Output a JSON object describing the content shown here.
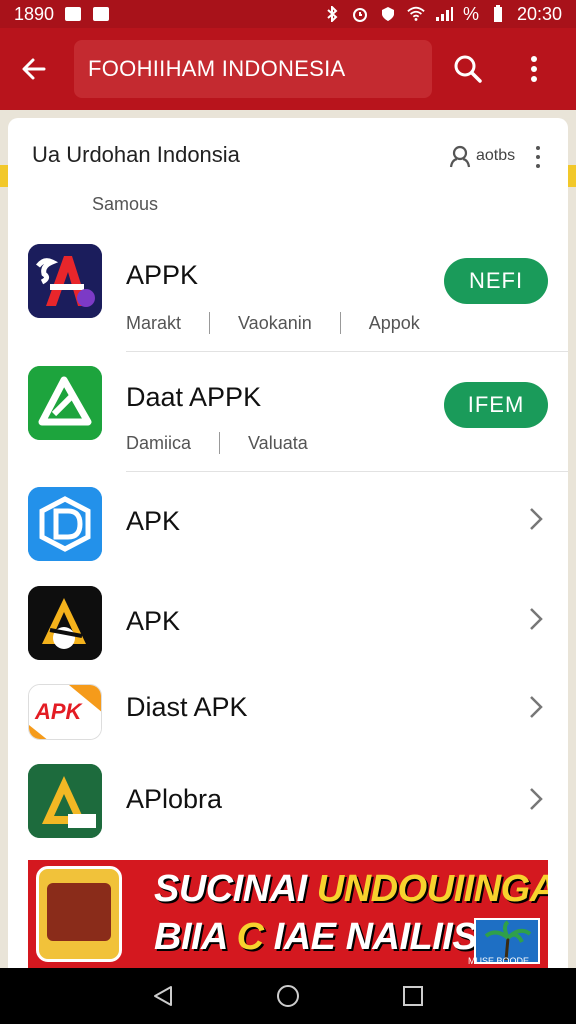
{
  "status_bar": {
    "time_left": "1890",
    "battery": "%",
    "time_right": "20:30"
  },
  "toolbar": {
    "search_text": "FOOHIIHAM INDONESIA"
  },
  "card": {
    "header": "Ua Urdohan Indonsia",
    "account_label": "aotbs",
    "section_label": "Samous"
  },
  "apps": [
    {
      "title": "APPK",
      "subs": [
        "Marakt",
        "Vaokanin",
        "Appok"
      ],
      "install": "NEFI"
    },
    {
      "title": "Daat APPK",
      "subs": [
        "Damiica",
        "Valuata"
      ],
      "install": "IFEM"
    },
    {
      "title": "APK"
    },
    {
      "title": "APK"
    },
    {
      "title": "Diast APK",
      "icon_text": "APK"
    },
    {
      "title": "APlobra"
    }
  ],
  "banner": {
    "line1_a": "SUCINAI ",
    "line1_b": "UNDOUIINGAN",
    "line2_a": "BIIA ",
    "line2_b": "C",
    "line2_c": " IAE NAILIIS",
    "logo_text": "MUSE BOODE"
  },
  "colors": {
    "brand_red": "#b8141c",
    "install_green": "#1a9b5a",
    "banner_yellow": "#f7d22e"
  },
  "icons": [
    "back-arrow-icon",
    "search-icon",
    "more-vert-icon",
    "account-icon",
    "chevron-right-icon",
    "nav-back-icon",
    "nav-home-icon",
    "nav-recents-icon"
  ]
}
